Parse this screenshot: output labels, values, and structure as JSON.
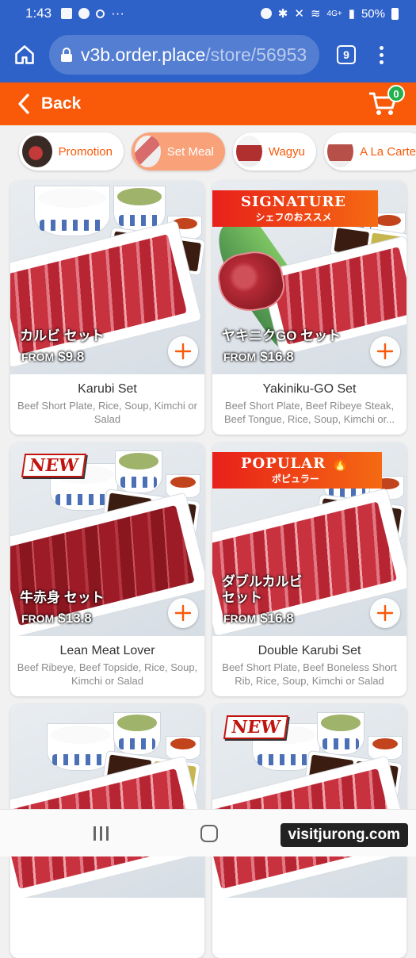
{
  "status_bar": {
    "time": "1:43",
    "signal": "4G+",
    "battery": "50%"
  },
  "browser": {
    "url_host": "v3b.order.place",
    "url_path": "/store/56953",
    "tab_count": "9"
  },
  "header": {
    "back_label": "Back",
    "cart_count": "0",
    "accent_color": "#f85a0a"
  },
  "categories": [
    {
      "label": "Promotion",
      "active": false
    },
    {
      "label": "Set Meal",
      "active": true
    },
    {
      "label": "Wagyu",
      "active": false
    },
    {
      "label": "A La Carte",
      "active": false
    }
  ],
  "products": [
    {
      "name": "Karubi Set",
      "desc": "Beef Short Plate, Rice, Soup, Kimchi or Salad",
      "jp": "カルビ セット",
      "from": "FROM",
      "price": "$9.8"
    },
    {
      "name": "Yakiniku-GO Set",
      "desc": "Beef Short Plate, Beef Ribeye Steak, Beef Tongue, Rice, Soup, Kimchi or...",
      "jp": "ヤキニクGO セット",
      "from": "FROM",
      "price": "$16.8",
      "tag": "SIGNATURE",
      "tag_sub": "シェフのおススメ"
    },
    {
      "name": "Lean Meat Lover",
      "desc": "Beef Ribeye, Beef Topside, Rice, Soup, Kimchi or Salad",
      "jp": "牛赤身 セット",
      "from": "FROM",
      "price": "$13.8",
      "tag": "NEW"
    },
    {
      "name": "Double Karubi Set",
      "desc": "Beef Short Plate, Beef Boneless Short Rib, Rice, Soup, Kimchi or Salad",
      "jp_line1": "ダブルカルビ",
      "jp_line2": "セット",
      "from": "FROM",
      "price": "$16.8",
      "tag": "POPULAR",
      "tag_sub": "ポピュラー"
    },
    {
      "name": ""
    },
    {
      "name": "",
      "tag": "NEW"
    }
  ],
  "watermark": "visitjurong.com"
}
